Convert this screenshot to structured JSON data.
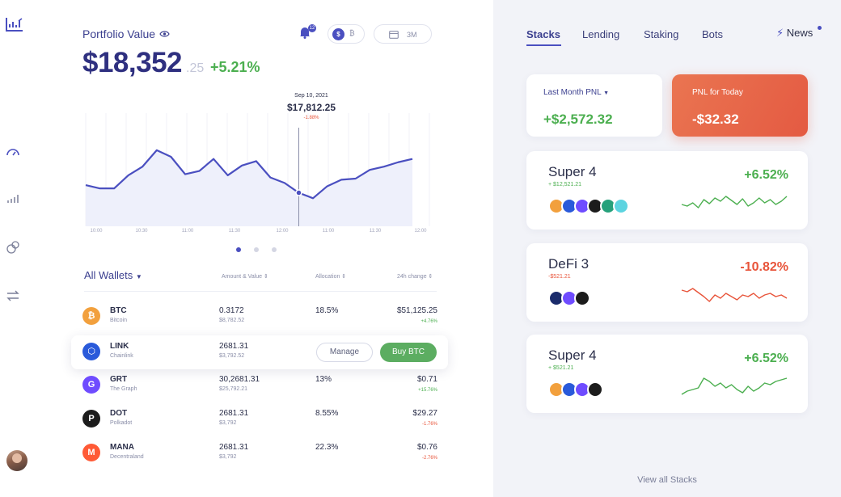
{
  "sidebar": {
    "icons": [
      "chart-logo-icon",
      "speedometer-icon",
      "bar-chart-icon",
      "coins-icon",
      "transfer-icon"
    ],
    "avatar": "avatar"
  },
  "header": {
    "title": "Portfolio Value",
    "notification_count": "12",
    "currency_active": "$",
    "currency_other": "₿",
    "range_label": "3M"
  },
  "portfolio": {
    "value": "$18,352",
    "cents": ".25",
    "change": "+5.21%"
  },
  "chart_data": {
    "type": "line",
    "x": [
      "10:00",
      "10:30",
      "11:00",
      "11:30",
      "12:00",
      "11:00",
      "11:30",
      "12:00"
    ],
    "points": [
      34,
      31,
      31,
      43,
      51,
      66,
      60,
      44,
      47,
      58,
      43,
      52,
      56,
      41,
      36,
      27,
      22,
      33,
      39,
      40,
      48,
      51,
      55,
      58
    ],
    "tooltip": {
      "date": "Sep 10, 2021",
      "value": "$17,812.25",
      "change": "-1.88%"
    },
    "highlight_index": 15,
    "ylim": [
      0,
      100
    ],
    "grid": true,
    "colors": {
      "line": "#4a4fc0",
      "fill": "#eef0fb"
    }
  },
  "pagination": {
    "count": 3,
    "active_index": 0
  },
  "wallets": {
    "title": "All Wallets",
    "columns": [
      "Amount & Value",
      "Allocation",
      "24h change"
    ],
    "rows": [
      {
        "symbol": "BTC",
        "name": "Bitcoin",
        "amount": "0.3172",
        "value": "$8,782.52",
        "allocation": "18.5%",
        "price": "$51,125.25",
        "change": "+4.76%",
        "direction": "up",
        "color": "#f2a03d",
        "glyph": "₿"
      },
      {
        "symbol": "LINK",
        "name": "Chainlink",
        "amount": "2681.31",
        "value": "$3,792.52",
        "allocation": "",
        "price": "",
        "change": "",
        "direction": "",
        "color": "#2a5ada",
        "glyph": "⬡",
        "hover": true,
        "manage_label": "Manage",
        "buy_label": "Buy BTC"
      },
      {
        "symbol": "GRT",
        "name": "The Graph",
        "amount": "30,2681.31",
        "value": "$25,792.21",
        "allocation": "13%",
        "price": "$0.71",
        "change": "+15.76%",
        "direction": "up",
        "color": "#6f4cff",
        "glyph": "G"
      },
      {
        "symbol": "DOT",
        "name": "Polkadot",
        "amount": "2681.31",
        "value": "$3,792",
        "allocation": "8.55%",
        "price": "$29.27",
        "change": "-1.76%",
        "direction": "down",
        "color": "#1c1c1c",
        "glyph": "P"
      },
      {
        "symbol": "MANA",
        "name": "Decentraland",
        "amount": "2681.31",
        "value": "$3,792",
        "allocation": "22.3%",
        "price": "$0.76",
        "change": "-2.76%",
        "direction": "down",
        "color": "#ff5a36",
        "glyph": "M"
      }
    ]
  },
  "right_panel": {
    "tabs": [
      {
        "label": "Stacks",
        "active": true
      },
      {
        "label": "Lending",
        "active": false
      },
      {
        "label": "Staking",
        "active": false
      },
      {
        "label": "Bots",
        "active": false
      }
    ],
    "news_label": "News",
    "last_month_pnl": {
      "label": "Last Month PNL",
      "value": "+$2,572.32"
    },
    "today_pnl": {
      "label": "PNL for Today",
      "value": "-$32.32"
    },
    "stacks": [
      {
        "name": "Super 4",
        "sub": "+ $12,521.21",
        "change": "+6.52%",
        "direction": "up",
        "coins": [
          "#f2a03d",
          "#2a5ada",
          "#6f4cff",
          "#1c1c1c",
          "#26a17b",
          "#5dd4e0"
        ],
        "spark": [
          20,
          22,
          18,
          24,
          14,
          19,
          12,
          16,
          10,
          15,
          20,
          13,
          22,
          18,
          12,
          18,
          14,
          20,
          16,
          10
        ]
      },
      {
        "name": "DeFi 3",
        "sub": "-$521.21",
        "change": "-10.82%",
        "direction": "down",
        "coins": [
          "#1a2b6b",
          "#6f4cff",
          "#1c1c1c"
        ],
        "spark": [
          12,
          14,
          10,
          15,
          20,
          26,
          18,
          22,
          16,
          20,
          24,
          18,
          20,
          16,
          22,
          18,
          16,
          20,
          18,
          22
        ]
      },
      {
        "name": "Super 4",
        "sub": "+ $521.21",
        "change": "+6.52%",
        "direction": "up",
        "coins": [
          "#f2a03d",
          "#2a5ada",
          "#6f4cff",
          "#1c1c1c"
        ],
        "spark": [
          28,
          24,
          22,
          20,
          8,
          12,
          18,
          14,
          20,
          16,
          22,
          26,
          18,
          24,
          20,
          14,
          16,
          12,
          10,
          8
        ]
      }
    ],
    "view_all": "View all Stacks"
  }
}
